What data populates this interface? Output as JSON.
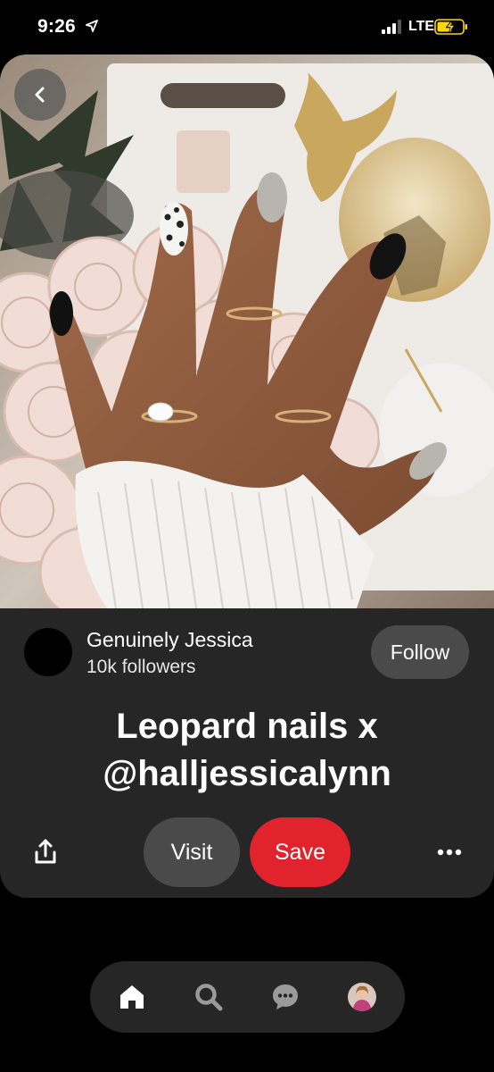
{
  "status_bar": {
    "time": "9:26",
    "network": "LTE",
    "icons": [
      "location-arrow-icon",
      "signal-bars-icon",
      "battery-charging-icon"
    ]
  },
  "pin": {
    "image_description_icon": "pin-photo",
    "author": {
      "name": "Genuinely Jessica",
      "followers": "10k followers"
    },
    "follow_label": "Follow",
    "title_lines": [
      "Leopard nails x",
      "@halljessicalynn"
    ],
    "visit_label": "Visit",
    "save_label": "Save"
  },
  "nav": {
    "items": [
      "home-icon",
      "search-icon",
      "messages-icon",
      "profile-avatar"
    ]
  },
  "colors": {
    "card_bg": "#262626",
    "button_gray": "#4a4a4a",
    "save_red": "#e0232c",
    "battery_yellow": "#ffd60a"
  }
}
